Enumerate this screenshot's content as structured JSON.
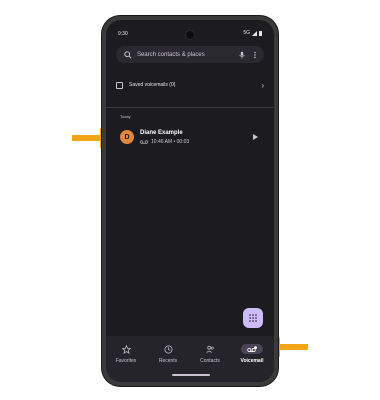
{
  "status_bar": {
    "time": "9:30",
    "network": "5G"
  },
  "search": {
    "placeholder": "Search contacts & places"
  },
  "saved_voicemails": {
    "label": "Saved voicemails (0)"
  },
  "section_header": "Today",
  "voicemails": [
    {
      "initial": "D",
      "name": "Diane Example",
      "meta": "10:46 AM • 00:03"
    }
  ],
  "nav": {
    "items": [
      {
        "label": "Favorites"
      },
      {
        "label": "Recents"
      },
      {
        "label": "Contacts"
      },
      {
        "label": "Voicemail",
        "active": true
      }
    ]
  },
  "colors": {
    "accent": "#cfbcff",
    "avatar": "#e3863a",
    "annotation_arrow": "#f2a516"
  }
}
